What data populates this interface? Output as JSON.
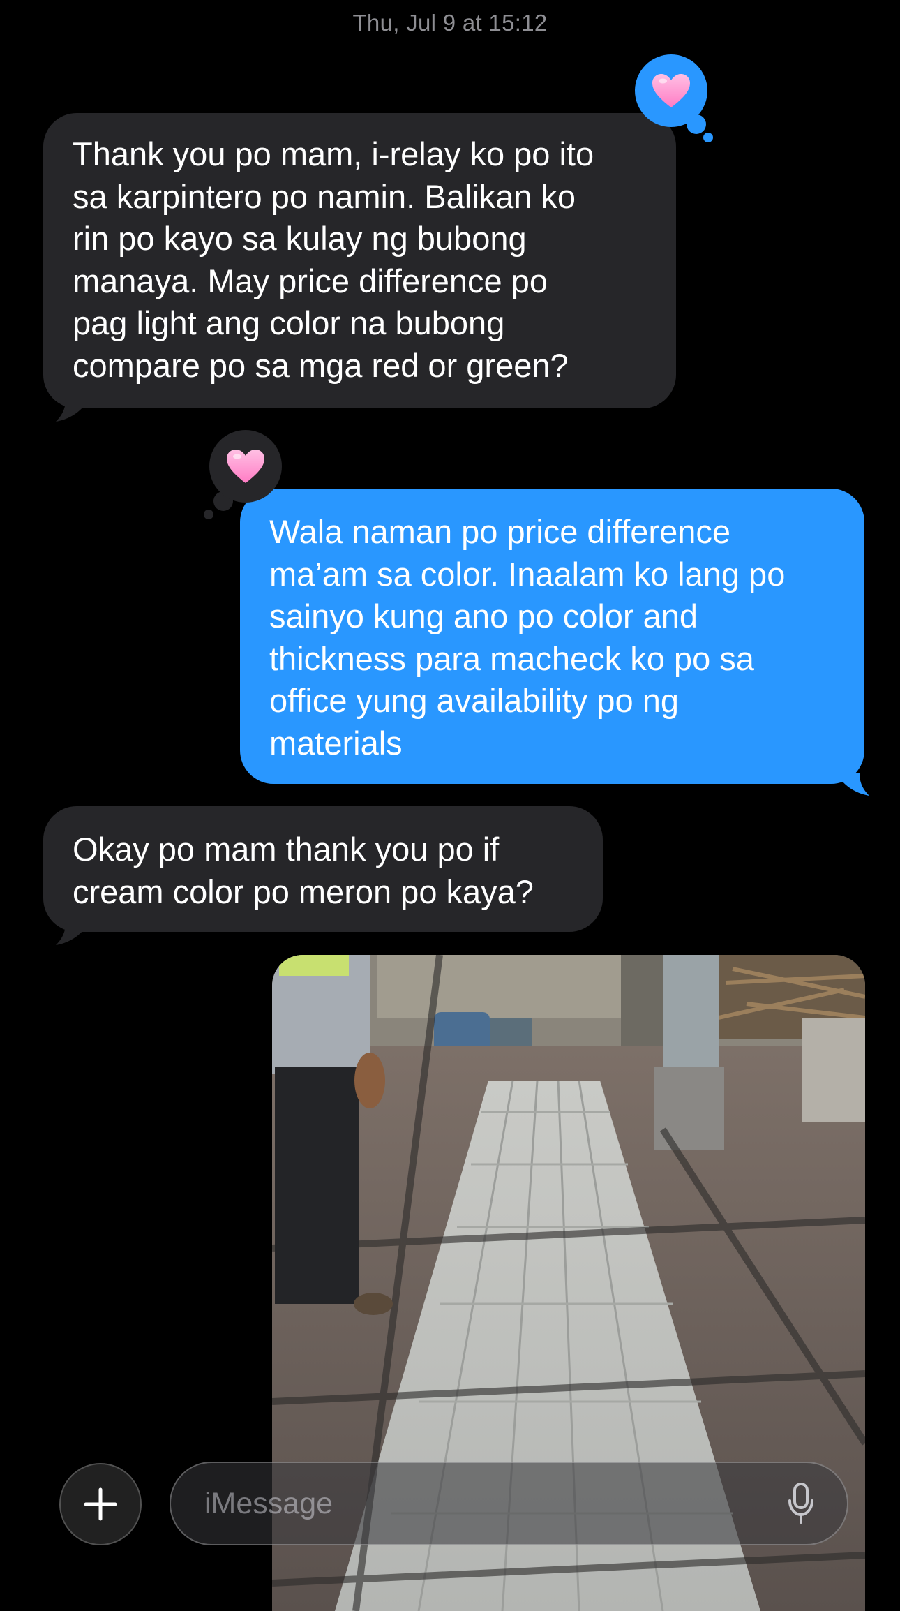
{
  "timestamp": "Thu, Jul 9 at 15:12",
  "messages": [
    {
      "direction": "incoming",
      "text": "Thank you po mam, i-relay ko po ito\nsa karpintero po namin. Balikan ko\nrin po kayo sa kulay ng bubong\nmanaya. May price difference po\npag light ang color na bubong\ncompare po sa mga red or green?",
      "tapback": "heart-icon"
    },
    {
      "direction": "outgoing",
      "text": "Wala naman po price difference\nma’am sa color. Inaalam ko lang po\nsainyo kung ano po color and\nthickness para macheck ko po sa\noffice yung availability po ng\nmaterials",
      "tapback": "heart-icon"
    },
    {
      "direction": "incoming",
      "text": "Okay po mam thank you po if\ncream color po meron po kaya?"
    },
    {
      "direction": "outgoing",
      "type": "photo",
      "subject": "roofing-sheets-photo"
    }
  ],
  "compose": {
    "placeholder": "iMessage",
    "plus_icon": "plus-icon",
    "mic_icon": "microphone-icon"
  },
  "colors": {
    "background": "#000000",
    "incoming_bubble": "#262629",
    "outgoing_bubble": "#2997ff",
    "tapback_pink": "#ff9ed2",
    "timestamp": "#8e8e93"
  }
}
